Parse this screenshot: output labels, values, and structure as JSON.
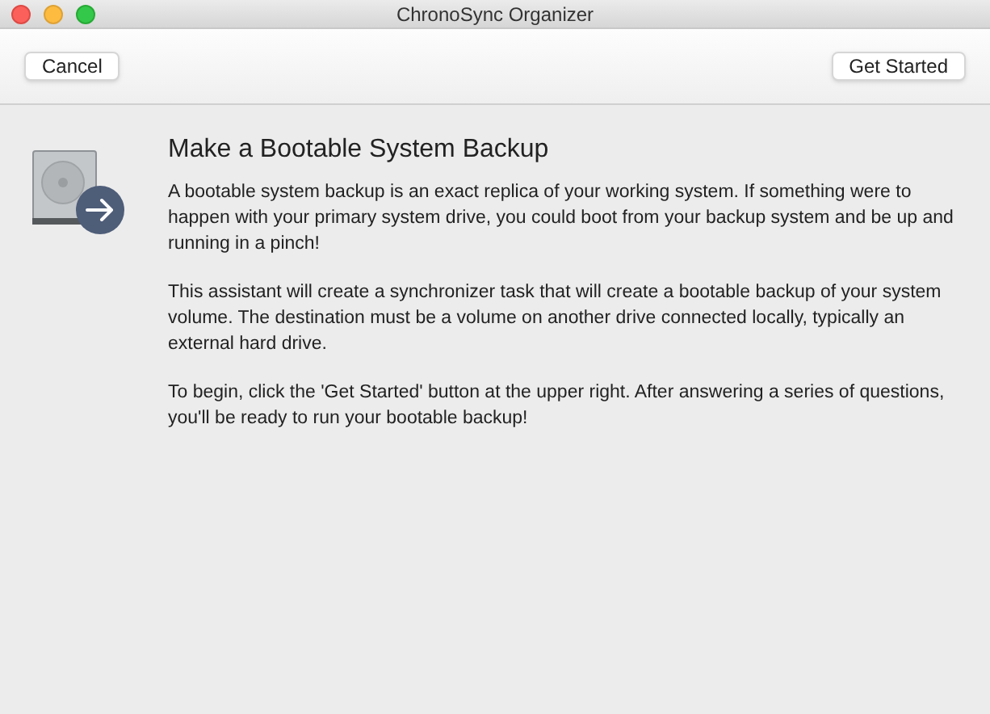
{
  "window": {
    "title": "ChronoSync Organizer"
  },
  "toolbar": {
    "buttons": [
      "Cancel",
      "Get Started"
    ]
  },
  "content": {
    "heading": "Make a Bootable System Backup",
    "paragraphs": [
      "A bootable system backup is an exact replica of your working system. If something were to happen with your primary system drive, you could boot from your backup system and be up and running in a pinch!",
      "This assistant will create a synchronizer task that will create a bootable backup of your system volume. The destination must be a volume on another drive connected locally, typically an external hard drive.",
      "To begin, click the 'Get Started' button at the upper right. After answering a series of questions, you'll be ready to run your bootable backup!"
    ]
  }
}
